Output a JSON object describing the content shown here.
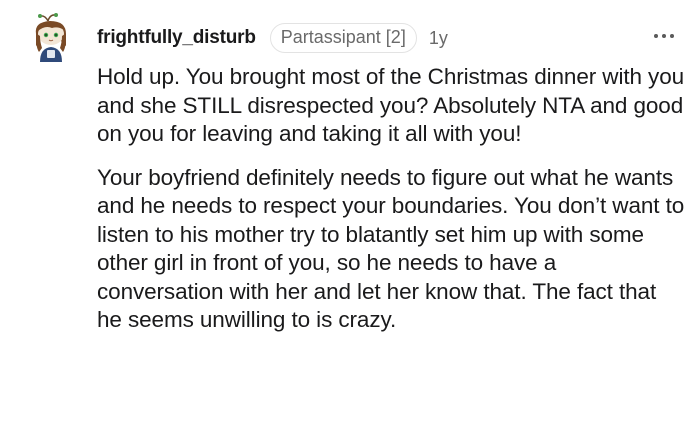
{
  "comment": {
    "username": "frightfully_disturb",
    "flair": "Partassipant [2]",
    "timestamp": "1y",
    "paragraphs": [
      "Hold up. You brought most of the Christmas dinner with you and she STILL disrespected you? Absolutely NTA and good on you for leaving and taking it all with you!",
      "Your boyfriend definitely needs to figure out what he wants and he needs to respect your boundaries. You don’t want to listen to his mother try to blatantly set him up with some other girl in front of you, so he needs to have a conversation with her and let her know that. The fact that he seems unwilling to is crazy."
    ],
    "icons": {
      "avatar": "snoo-avatar",
      "more": "more-options-icon"
    }
  }
}
